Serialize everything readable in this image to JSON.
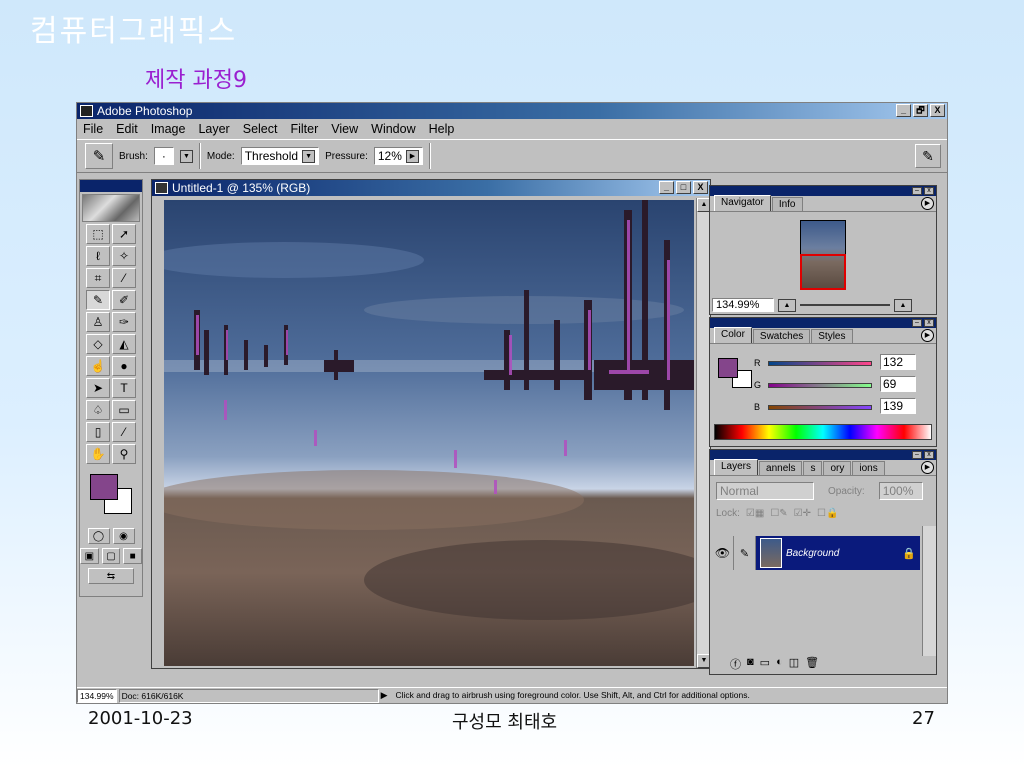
{
  "slide": {
    "title": "컴퓨터그래픽스",
    "subtitle": "제작 과정9",
    "footer_date": "2001-10-23",
    "footer_author": "구성모 최태호",
    "page_number": "27"
  },
  "app": {
    "title": "Adobe Photoshop",
    "window_buttons": [
      "_",
      "🗗",
      "X"
    ]
  },
  "menu": [
    "File",
    "Edit",
    "Image",
    "Layer",
    "Select",
    "Filter",
    "View",
    "Window",
    "Help"
  ],
  "options": {
    "brush_label": "Brush:",
    "brush_value": "·",
    "mode_label": "Mode:",
    "mode_value": "Threshold",
    "pressure_label": "Pressure:",
    "pressure_value": "12%"
  },
  "document": {
    "title": "Untitled-1 @ 135% (RGB)"
  },
  "navigator": {
    "tabs": [
      "Navigator",
      "Info"
    ],
    "zoom": "134.99%"
  },
  "color_panel": {
    "tabs": [
      "Color",
      "Swatches",
      "Styles"
    ],
    "r_label": "R",
    "r_value": "132",
    "g_label": "G",
    "g_value": "69",
    "b_label": "B",
    "b_value": "139",
    "foreground_color": "#84458b"
  },
  "layers_panel": {
    "tabs": [
      "Layers",
      "annels",
      "s",
      "ory",
      "ions"
    ],
    "blend_mode": "Normal",
    "opacity_label": "Opacity:",
    "opacity_value": "100%",
    "lock_label": "Lock:",
    "layer_name": "Background"
  },
  "status": {
    "zoom": "134.99%",
    "doc": "Doc: 616K/616K",
    "hint": "Click and drag to airbrush using foreground color.  Use Shift, Alt, and Ctrl for additional options."
  }
}
